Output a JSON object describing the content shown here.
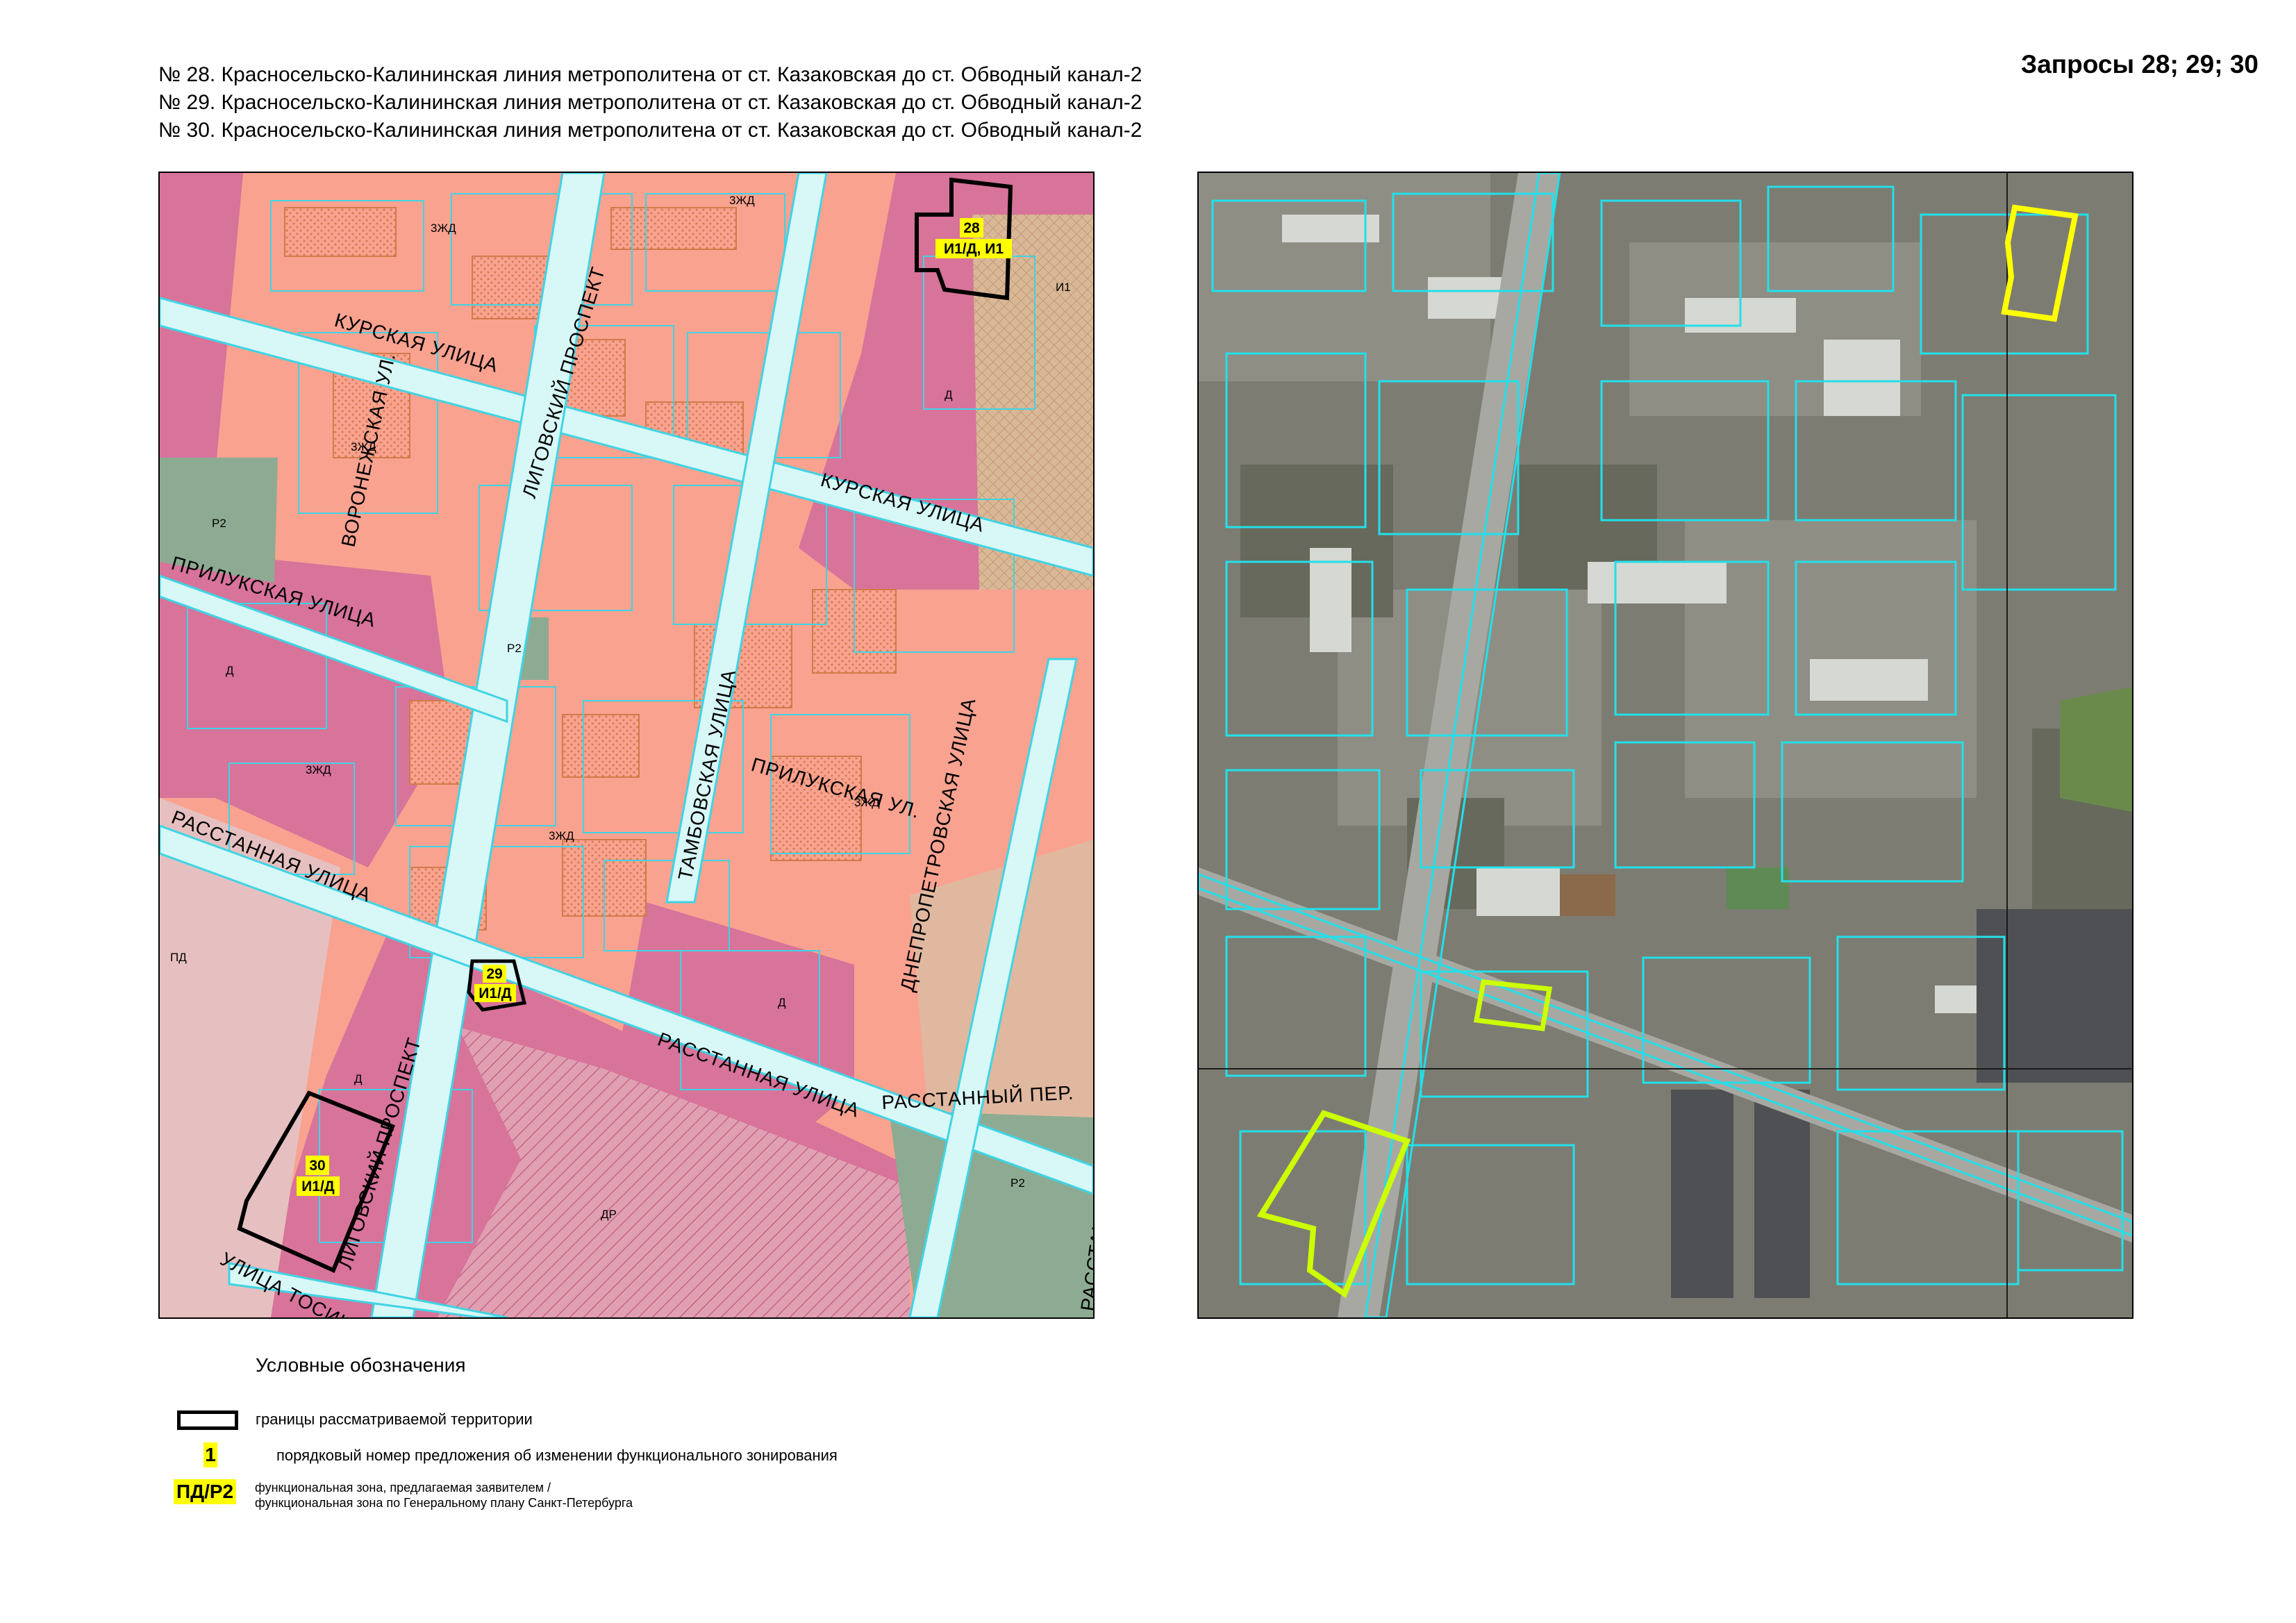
{
  "header": {
    "lines": [
      "№ 28. Красносельско-Калининская линия метрополитена от ст. Казаковская до ст. Обводный канал-2",
      "№ 29. Красносельско-Калининская линия метрополитена от ст. Казаковская до ст. Обводный канал-2",
      "№ 30. Красносельско-Калининская линия метрополитена от ст. Казаковская до ст. Обводный канал-2"
    ],
    "request_title": "Запросы 28; 29; 30"
  },
  "zoning_map": {
    "streets": {
      "kurskaya_upper": "КУРСКАЯ УЛИЦА",
      "kurskaya_lower": "КУРСКАЯ УЛИЦА",
      "ligovsky_upper": "ЛИГОВСКИЙ ПРОСПЕКТ",
      "ligovsky_lower": "ЛИГОВСКИЙ ПРОСПЕКТ",
      "voronezhskaya": "ВОРОНЕЖСКАЯ УЛ.",
      "prilukskaya_left": "ПРИЛУКСКАЯ УЛИЦА",
      "prilukskaya_right": "ПРИЛУКСКАЯ УЛ.",
      "tambovskaya": "ТАМБОВСКАЯ УЛИЦА",
      "dnepropetrovskaya": "ДНЕПРОПЕТРОВСКАЯ УЛИЦА",
      "rasstannaya_left": "РАССТАННАЯ УЛИЦА",
      "rasstannaya_right": "РАССТАННАЯ УЛИЦА",
      "rasstanny_per": "РАССТАННЫЙ ПЕР.",
      "rasstanny_edge": "РАССТАННЫЙ",
      "tosina": "УЛИЦА ТОСИНА"
    },
    "zone_labels": {
      "zzhd_top1": "3ЖД",
      "zzhd_top2": "3ЖД",
      "zzhd_mid1": "3ЖД",
      "zzhd_mid2": "3ЖД",
      "zzhd_mid3": "3ЖД",
      "zzhd_mid4": "3ЖД",
      "i1": "И1",
      "d_top": "Д",
      "r2_left": "Р2",
      "r2_mid": "Р2",
      "d_left": "Д",
      "pd": "ПД",
      "d_mid": "Д",
      "d_bottom": "Д",
      "dr": "ДР",
      "r2_right": "Р2"
    },
    "proposals": [
      {
        "number": "28",
        "zone": "И1/Д, И1"
      },
      {
        "number": "29",
        "zone": "И1/Д"
      },
      {
        "number": "30",
        "zone": "И1/Д"
      }
    ],
    "colors": {
      "zzhd": "#f9a290",
      "d": "#d8739a",
      "dr": "#e0a0b2",
      "pd": "#e6c0c0",
      "i1": "#d9b898",
      "r2": "#8dab92",
      "street": "#d8f7f7",
      "outline": "#3fd4e4",
      "highlight": "#ffff00"
    }
  },
  "legend": {
    "title": "Условные обозначения",
    "boundary_label": "границы рассматриваемой территории",
    "number_symbol": "1",
    "number_label": "порядковый номер предложения об изменении функционального зонирования",
    "zone_symbol": "ПД/Р2",
    "zone_label_line1": "функциональная зона, предлагаемая заявителем /",
    "zone_label_line2": "функциональная зона по Генеральному плану Санкт-Петербурга"
  }
}
